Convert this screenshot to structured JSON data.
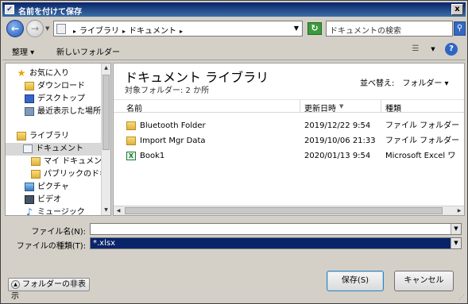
{
  "window": {
    "title": "名前を付けて保存",
    "close_glyph": "x"
  },
  "address": {
    "crumbs": [
      "ライブラリ",
      "ドキュメント"
    ],
    "search_placeholder": "ドキュメントの検索"
  },
  "toolbar": {
    "organize": "整理 ▾",
    "new_folder": "新しいフォルダー"
  },
  "sidebar": {
    "items": [
      {
        "label": "お気に入り",
        "icon": "star-icon"
      },
      {
        "label": "ダウンロード",
        "icon": "folder-icon"
      },
      {
        "label": "デスクトップ",
        "icon": "desktop-icon"
      },
      {
        "label": "最近表示した場所",
        "icon": "recent-icon"
      },
      {
        "label": "ライブラリ",
        "icon": "library-icon"
      },
      {
        "label": "ドキュメント",
        "icon": "documents-icon",
        "selected": true
      },
      {
        "label": "マイ ドキュメント",
        "icon": "folder-icon"
      },
      {
        "label": "パブリックのドキュメ",
        "icon": "folder-icon"
      },
      {
        "label": "ピクチャ",
        "icon": "pictures-icon"
      },
      {
        "label": "ビデオ",
        "icon": "video-icon"
      },
      {
        "label": "ミュージック",
        "icon": "music-icon"
      }
    ]
  },
  "main": {
    "title": "ドキュメント ライブラリ",
    "subtitle": "対象フォルダー: 2 か所",
    "arrange_by": "並べ替え:　フォルダー ▾",
    "columns": [
      "名前",
      "更新日時",
      "種類"
    ],
    "rows": [
      {
        "name": "Bluetooth Folder",
        "date": "2019/12/22 9:54",
        "type": "ファイル フォルダー",
        "icon": "folder-icon"
      },
      {
        "name": "Import Mgr Data",
        "date": "2019/10/06 21:33",
        "type": "ファイル フォルダー",
        "icon": "folder-icon"
      },
      {
        "name": "Book1",
        "date": "2020/01/13 9:54",
        "type": "Microsoft Excel ワ",
        "icon": "excel-icon"
      }
    ]
  },
  "form": {
    "filename_label": "ファイル名(N):",
    "filename_value": "",
    "filetype_label": "ファイルの種類(T):",
    "filetype_value": "*.xlsx"
  },
  "buttons": {
    "save": "保存(S)",
    "cancel": "キャンセル",
    "hide_folders": "フォルダーの非表示"
  }
}
